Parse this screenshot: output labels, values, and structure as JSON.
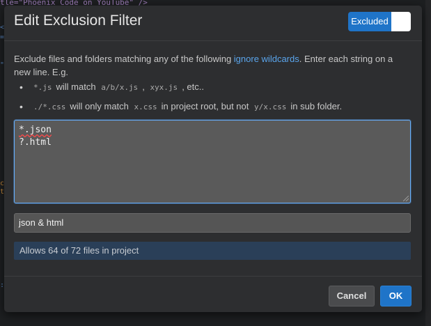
{
  "background": {
    "code_line": "tle=\"Phoenix Code on YouTube\" />"
  },
  "dialog": {
    "title": "Edit Exclusion Filter",
    "toggle": {
      "label": "Excluded",
      "state": "on",
      "color": "#1f74c8"
    },
    "description": {
      "before_link": "Exclude files and folders matching any of the following ",
      "link": "ignore wildcards",
      "after_link": ". Enter each string on a new line. E.g."
    },
    "examples": [
      {
        "code1": "*.js",
        "text1": "will match",
        "code2": "a/b/x.js",
        "text2": ",",
        "code3": "xyx.js",
        "text3": ", etc.."
      },
      {
        "code1": "./*.css",
        "text1": "will only match",
        "code2": "x.css",
        "text2": "in project root, but not",
        "code3": "y/x.css",
        "text3": "in sub folder."
      }
    ],
    "filter_lines": [
      "*.json",
      "?.html"
    ],
    "filter_name": "json & html",
    "status": "Allows 64 of 72 files in project",
    "buttons": {
      "cancel": "Cancel",
      "ok": "OK"
    },
    "colors": {
      "accent": "#1f74c8",
      "link": "#5aa5ec",
      "focus_border": "#66b0ff"
    }
  }
}
